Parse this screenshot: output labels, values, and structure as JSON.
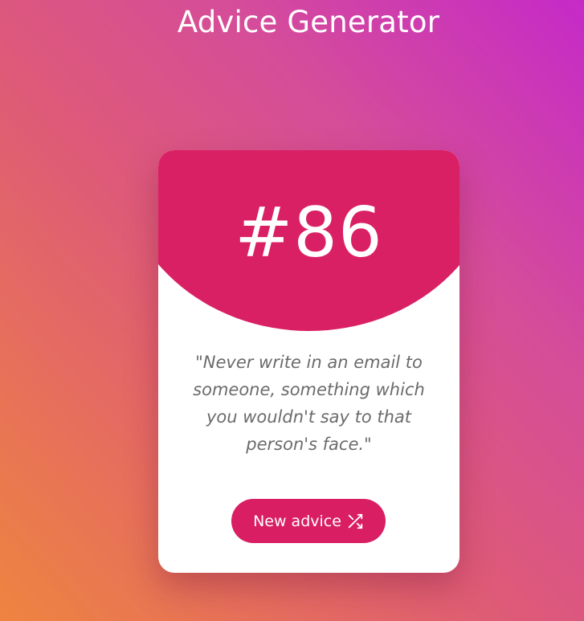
{
  "page": {
    "title": "Advice Generator"
  },
  "card": {
    "number": "#86",
    "quote": "\"Never write in an email to someone, something which you wouldn't say to that person's face.\"",
    "button_label": "New advice",
    "button_icon": "shuffle-icon"
  },
  "colors": {
    "accent": "#da2065",
    "card_background": "#ffffff",
    "quote_text": "#6b6b6b",
    "gradient_start": "#ee8440",
    "gradient_end": "#c52ac8"
  }
}
